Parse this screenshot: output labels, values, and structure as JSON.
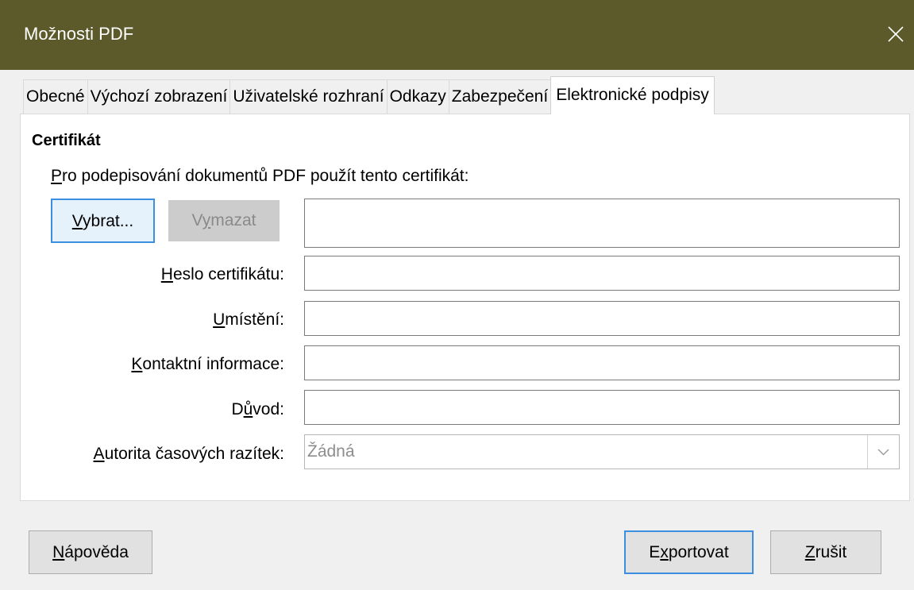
{
  "window": {
    "title": "Možnosti PDF",
    "titlebar_color": "#5c5a2a",
    "close_icon": "close-icon"
  },
  "tabs": [
    {
      "label": "Obecné"
    },
    {
      "label": "Výchozí zobrazení"
    },
    {
      "label": "Uživatelské rozhraní"
    },
    {
      "label": "Odkazy"
    },
    {
      "label": "Zabezpečení"
    },
    {
      "label": "Elektronické podpisy",
      "active": true
    }
  ],
  "certificate": {
    "section_title": "Certifikát",
    "hint_prefix": "P",
    "hint_rest": "ro podepisování dokumentů PDF použít tento certifikát:",
    "select_button": {
      "accel": "V",
      "rest": "ybrat..."
    },
    "clear_button": {
      "pre": "V",
      "accel": "y",
      "rest": "mazat"
    },
    "certificate_value": ""
  },
  "fields": {
    "password": {
      "accel": "H",
      "rest": "eslo certifikátu:",
      "value": ""
    },
    "location": {
      "accel": "U",
      "rest": "místění:",
      "value": ""
    },
    "contact": {
      "accel": "K",
      "rest": "ontaktní informace:",
      "value": ""
    },
    "reason": {
      "pre": "D",
      "accel": "ů",
      "rest": "vod:",
      "value": ""
    },
    "tsa": {
      "accel": "A",
      "rest": "utorita časových razítek:",
      "value": "Žádná"
    }
  },
  "footer": {
    "help": {
      "accel": "N",
      "rest": "ápověda"
    },
    "export": {
      "pre": "E",
      "accel": "x",
      "rest": "portovat"
    },
    "cancel": {
      "accel": "Z",
      "rest": "rušit"
    }
  },
  "accent_color": "#3c8ee0"
}
